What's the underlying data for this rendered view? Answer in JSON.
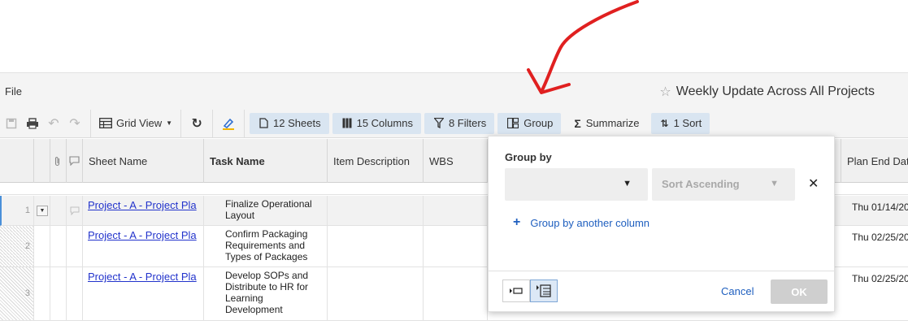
{
  "menu": {
    "file": "File"
  },
  "report": {
    "title": "Weekly Update Across All Projects",
    "favorite_icon": "star-icon"
  },
  "toolbar": {
    "grid_view": "Grid View",
    "sheets": "12 Sheets",
    "columns": "15 Columns",
    "filters": "8 Filters",
    "group": "Group",
    "summarize": "Summarize",
    "sort": "1 Sort"
  },
  "grid": {
    "columns": [
      "Sheet Name",
      "Task Name",
      "Item Description",
      "WBS",
      "Plan End Dat"
    ],
    "rows": [
      {
        "num": "1",
        "sheet": "Project - A - Project Pla",
        "task": "Finalize Operational Layout",
        "date": "Thu 01/14/20"
      },
      {
        "num": "2",
        "sheet": "Project - A - Project Pla",
        "task": "Confirm Packaging Requirements and Types of Packages",
        "date": "Thu 02/25/20"
      },
      {
        "num": "3",
        "sheet": "Project - A - Project Pla",
        "task": "Develop SOPs and Distribute to HR for Learning Development",
        "date": "Thu 02/25/20"
      }
    ]
  },
  "group_panel": {
    "title": "Group by",
    "sort_placeholder": "Sort Ascending",
    "add_link": "Group by another column",
    "cancel": "Cancel",
    "ok": "OK"
  },
  "colors": {
    "accent": "#1f5fbf",
    "chip_bg": "#d9e5f1",
    "arrow": "#e02020"
  }
}
